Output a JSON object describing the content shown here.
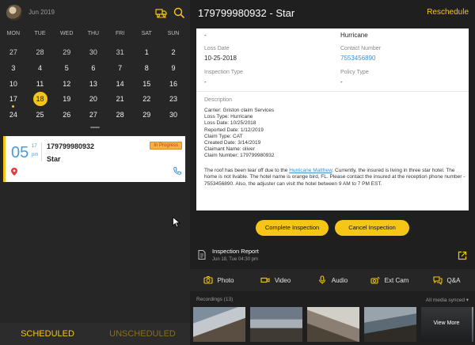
{
  "left": {
    "month_label": "Jun 2019",
    "icons": [
      "avatar",
      "truck-filter-icon",
      "search-icon"
    ],
    "weekdays": [
      "MON",
      "TUE",
      "WED",
      "THU",
      "FRI",
      "SAT",
      "SUN"
    ],
    "weeks": [
      [
        "27",
        "28",
        "29",
        "30",
        "31",
        "1",
        "2"
      ],
      [
        "3",
        "4",
        "5",
        "6",
        "7",
        "8",
        "9"
      ],
      [
        "10",
        "11",
        "12",
        "13",
        "14",
        "15",
        "16"
      ],
      [
        "17",
        "18",
        "19",
        "20",
        "21",
        "22",
        "23"
      ],
      [
        "24",
        "25",
        "26",
        "27",
        "28",
        "29",
        "30"
      ]
    ],
    "selected_day": "18",
    "appointment": {
      "hour": "05",
      "minute": "17",
      "ampm": "pm",
      "number": "179799980932",
      "name": "Star",
      "badge": "In Progress"
    },
    "tabs": {
      "scheduled": "SCHEDULED",
      "unscheduled": "UNSCHEDULED"
    }
  },
  "right": {
    "title": "179799980932 - Star",
    "action": "Reschedule",
    "details": {
      "top_left_value": "-",
      "top_right_value": "Hurricane",
      "loss_date_label": "Loss Date",
      "loss_date": "10-25-2018",
      "contact_label": "Contact Number",
      "contact": "7553456890",
      "inspection_type_label": "Inspection Type",
      "inspection_type": "-",
      "policy_type_label": "Policy Type",
      "policy_type": "-",
      "description_label": "Description",
      "description_lines": [
        "Carrier: Griston claim Services",
        "Loss Type: Hurricane",
        "Loss Date: 10/25/2018",
        "Reported Date: 1/12/2019",
        "Claim Type: CAT",
        "Created Date: 3/14/2019",
        "Claimant Name: oliver",
        "Claim Number: 179799980932"
      ],
      "para_before_link": "The roof has been tear off due to the ",
      "para_link": "Hurricane Matthew",
      "para_after_link": ". Currently, the insured is living in three star hotel. The home is not livable. The hotel name is orange bird, FL. Please contact the insured at the reception phone number - 7553456890. Also, the adjuster can visit the hotel between 9 AM to 7 PM EST."
    },
    "buttons": {
      "complete": "Complete Inspection",
      "cancel": "Cancel Inspection"
    },
    "report": {
      "title": "Inspection Report",
      "subtitle": "Jun 18, Tue 04:30 pm"
    },
    "media": [
      "Photo",
      "Video",
      "Audio",
      "Ext Cam",
      "Q&A"
    ],
    "recordings_label": "Recordings (13)",
    "sync_label": "All media synced ▾",
    "view_more": "View More",
    "colors": {
      "accent": "#f5c518",
      "link": "#3d8fd0",
      "background": "#1f1f1f"
    }
  }
}
